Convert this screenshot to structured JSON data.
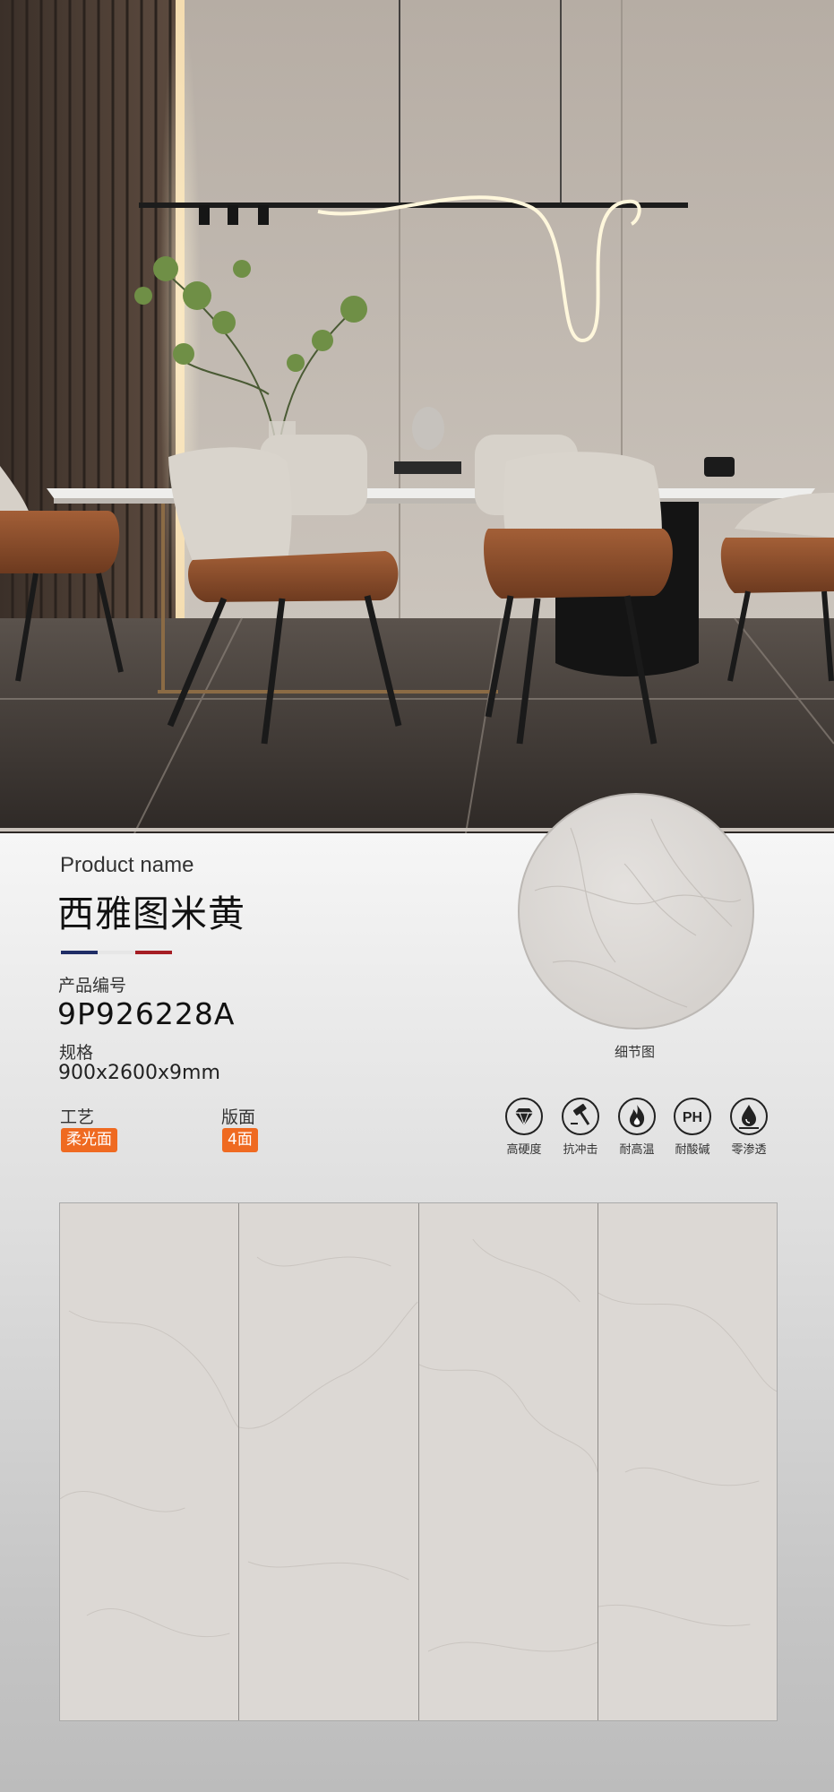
{
  "product": {
    "name_label": "Product name",
    "name_value": "西雅图米黄",
    "code_label": "产品编号",
    "code_value": "9P926228A",
    "spec_label": "规格",
    "spec_value": "900x2600x9mm",
    "craft_label": "工艺",
    "craft_value": "柔光面",
    "face_label": "版面",
    "face_value": "4面"
  },
  "detail": {
    "caption": "细节图"
  },
  "features": [
    {
      "label": "高硬度",
      "icon": "diamond-icon"
    },
    {
      "label": "抗冲击",
      "icon": "hammer-icon"
    },
    {
      "label": "耐高温",
      "icon": "flame-icon"
    },
    {
      "label": "耐酸碱",
      "icon": "ph-icon",
      "icon_text": "PH"
    },
    {
      "label": "零渗透",
      "icon": "water-drop-icon"
    }
  ],
  "slabs": {
    "count_shown": 4
  },
  "colors": {
    "accent_orange": "#ef6a21",
    "stripe_navy": "#1f2d66",
    "stripe_white": "#e9e9e9",
    "stripe_red": "#a51d23",
    "slab_color": "#dcd8d4"
  }
}
